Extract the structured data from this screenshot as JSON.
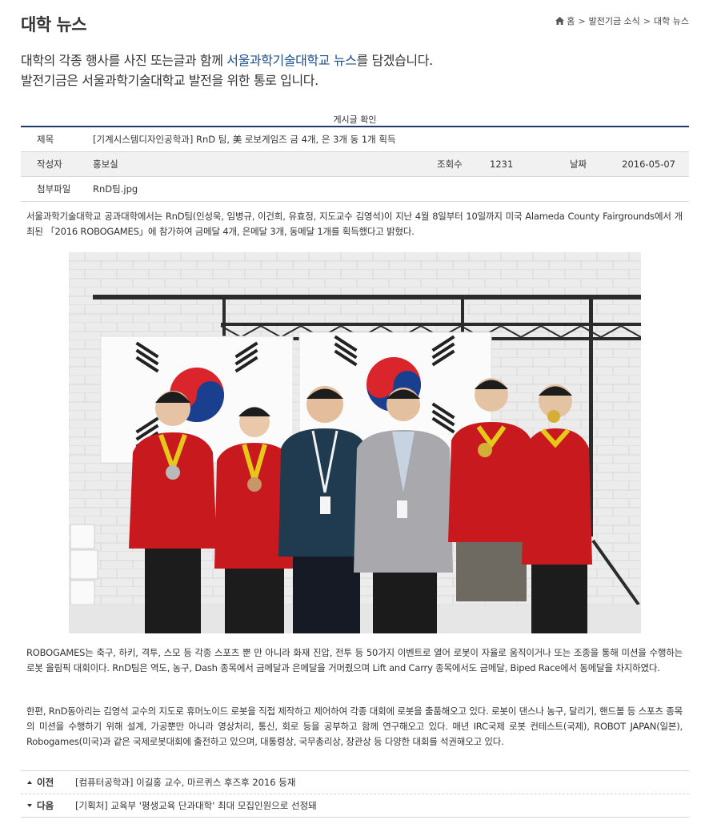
{
  "page": {
    "title": "대학 뉴스",
    "breadcrumb": [
      "홈",
      "발전기금 소식",
      "대학 뉴스"
    ]
  },
  "intro": {
    "line1_pre": "대학의 각종 행사를 사진 또는글과 함께 ",
    "line1_highlight": "서울과학기술대학교 뉴스",
    "line1_post": "를 담겠습니다.",
    "line2": "발전기금은 서울과학기술대학교 발전을 위한 통로 입니다."
  },
  "board": {
    "caption": "게시글 확인",
    "title_label": "제목",
    "title_value": "[기계시스템디자인공학과] RnD 팀, 美 로보게임즈 금 4개, 은 3개 동 1개 획득",
    "author_label": "작성자",
    "author_value": "홍보실",
    "views_label": "조회수",
    "views_value": "1231",
    "date_label": "날짜",
    "date_value": "2016-05-07",
    "file_label": "첨부파일",
    "file_value": "RnD팀.jpg"
  },
  "article": {
    "p1": "서울과학기술대학교 공과대학에서는 RnD팀(인성욱, 임병규, 이건희, 유효정, 지도교수 김영석)이 지난 4월 8일부터 10일까지 미국 Alameda County Fairgrounds에서 개최된 「2016 ROBOGAMES」에 참가하여 금메달 4개, 은메달 3개, 동메달 1개를 획득했다고 밝혔다.",
    "p2": "ROBOGAMES는 축구, 하키, 격투, 스모 등 각종 스포츠 뿐 만 아니라 화재 진압, 전투 등 50가지 이벤트로 열어 로봇이 자율로 움직이거나 또는 조종을 통해 미션을 수행하는 로봇 올림픽 대회이다. RnD팀은 역도, 농구, Dash 종목에서 금메달과 은메달을 거머줬으며 Lift and Carry 종목에서도 금메달, Biped Race에서 동메달을 차지하였다.",
    "p3": "한편, RnD동아리는 김영석 교수의 지도로 휴머노이드 로봇을 직접 제작하고 제어하여 각종 대회에 로봇을 출품해오고 있다. 로봇이 댄스나 농구, 달리기, 핸드볼 등 스포츠 종목의 미션을 수행하기 위해 설계, 가공뿐만 아니라 영상처리, 통신, 회로 등을 공부하고 함께 연구해오고 있다. 매년 IRC국제 로봇 컨테스트(국제), ROBOT JAPAN(일본), Robogames(미국)과 같은 국제로봇대회에 출전하고 있으며, 대통령상, 국무총리상, 장관상 등 다양한 대회를 석권해오고 있다."
  },
  "nav": {
    "prev_label": "이전",
    "prev_title": "[컴퓨터공학과] 이길홍 교수, 마르퀴스 후즈후 2016 등재",
    "next_label": "다음",
    "next_title": "[기획처] 교육부 '평생교육 단과대학' 최대 모집인원으로 선정돼"
  },
  "colors": {
    "accent": "#1d4f8c",
    "table_rule": "#1f3a6b",
    "jacket_red": "#c8191e"
  },
  "icons": [
    "home-icon",
    "arrow-up-icon",
    "arrow-down-icon"
  ]
}
